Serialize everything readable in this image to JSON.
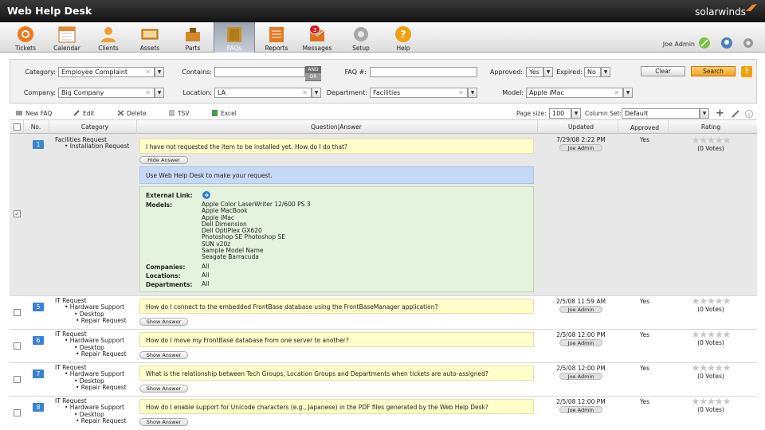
{
  "app": {
    "title": "Web Help Desk",
    "brand": "solarwinds"
  },
  "nav": [
    {
      "label": "Tickets",
      "icon": "tickets-icon",
      "color": "#f07a1a"
    },
    {
      "label": "Calendar",
      "icon": "calendar-icon",
      "color": "#e8a040"
    },
    {
      "label": "Clients",
      "icon": "clients-icon",
      "color": "#f0a030"
    },
    {
      "label": "Assets",
      "icon": "assets-icon",
      "color": "#e89428"
    },
    {
      "label": "Parts",
      "icon": "parts-icon",
      "color": "#d08a2a"
    },
    {
      "label": "FAQs",
      "icon": "faqs-icon",
      "color": "#c8902c"
    },
    {
      "label": "Reports",
      "icon": "reports-icon",
      "color": "#e27a22"
    },
    {
      "label": "Messages",
      "icon": "messages-icon",
      "color": "#e07020",
      "badge": "3"
    },
    {
      "label": "Setup",
      "icon": "setup-icon",
      "color": "#a8a8a8"
    },
    {
      "label": "Help",
      "icon": "help-icon",
      "color": "#f3a010"
    }
  ],
  "user": {
    "name": "Joe Admin"
  },
  "filters": {
    "category_label": "Category:",
    "category_value": "Employee Complaint",
    "contains_label": "Contains:",
    "contains_value": "",
    "and_label": "AND",
    "or_label": "OR",
    "faq_label": "FAQ #:",
    "faq_value": "",
    "approved_label": "Approved:",
    "approved_value": "Yes",
    "expired_label": "Expired:",
    "expired_value": "No",
    "clear_label": "Clear",
    "search_label": "Search",
    "help_label": "?",
    "company_label": "Company:",
    "company_value": "Big Company",
    "location_label": "Location:",
    "location_value": "LA",
    "department_label": "Department:",
    "department_value": "Facilities",
    "model_label": "Model:",
    "model_value": "Apple iMac"
  },
  "toolbar": {
    "new_faq": "New FAQ",
    "edit": "Edit",
    "delete": "Delete",
    "tsv": "TSV",
    "excel": "Excel",
    "page_size_label": "Page size:",
    "page_size_value": "100",
    "column_set_label": "Column Set:",
    "column_set_value": "Default"
  },
  "table": {
    "headers": {
      "no": "No.",
      "category": "Category",
      "qa": "Question|Answer",
      "updated": "Updated",
      "approved": "Approved",
      "rating": "Rating"
    },
    "rows": [
      {
        "no": "1",
        "cat": [
          "Facilities Request",
          "• Installation Request"
        ],
        "question": "I have not requested the item to be installed yet.  How do I do that?",
        "toggle": "Hide Answer",
        "answer": "Use Web Help Desk to make your request.",
        "date": "7/29/08 2:22 PM",
        "who": "Joe Admin",
        "approved": "Yes",
        "votes": "(0 Votes)",
        "checked": "✓"
      },
      {
        "no": "5",
        "cat": [
          "IT Request",
          "• Hardware Support",
          "• Desktop",
          "• Repair Request"
        ],
        "question": "How do I connect to the embedded FrontBase database using the FrontBaseManager application?",
        "toggle": "Show Answer",
        "date": "2/5/08 11:59 AM",
        "who": "Joe Admin",
        "approved": "Yes",
        "votes": "(0 Votes)"
      },
      {
        "no": "6",
        "cat": [
          "IT Request",
          "• Hardware Support",
          "• Desktop",
          "• Repair Request"
        ],
        "question": "How do I move my FrontBase database from one server to another?",
        "toggle": "Show Answer",
        "date": "2/5/08 12:00 PM",
        "who": "Joe Admin",
        "approved": "Yes",
        "votes": "(0 Votes)"
      },
      {
        "no": "7",
        "cat": [
          "IT Request",
          "• Hardware Support",
          "• Desktop",
          "• Repair Request"
        ],
        "question": "What is the relationship between Tech Groups, Location Groups and Departments when tickets are auto-assigned?",
        "toggle": "Show Answer",
        "date": "2/5/08 12:00 PM",
        "who": "Joe Admin",
        "approved": "Yes",
        "votes": "(0 Votes)"
      },
      {
        "no": "8",
        "cat": [
          "IT Request",
          "• Hardware Support",
          "• Desktop",
          "• Repair Request"
        ],
        "question": "How do I enable support for Unicode characters (e.g., Japanese) in the PDF files generated by the Web Help Desk?",
        "toggle": "Show Answer",
        "date": "2/5/08 12:00 PM",
        "who": "Joe Admin",
        "approved": "Yes",
        "votes": "(0 Votes)"
      }
    ]
  },
  "details": {
    "external_link_label": "External Link:",
    "models_label": "Models:",
    "models": [
      "Apple Color LaserWriter 12/600 PS 3",
      "Apple MacBook",
      "Apple iMac",
      "Dell Dimension",
      "Dell OptiPlex GX620",
      "Photoshop SE Photoshop SE",
      "SUN v20z",
      "Sample Model Name",
      "Seagate Barracuda"
    ],
    "companies_label": "Companies:",
    "companies_value": "All",
    "locations_label": "Locations:",
    "locations_value": "All",
    "departments_label": "Departments:",
    "departments_value": "All"
  },
  "stars": "★★★★★"
}
